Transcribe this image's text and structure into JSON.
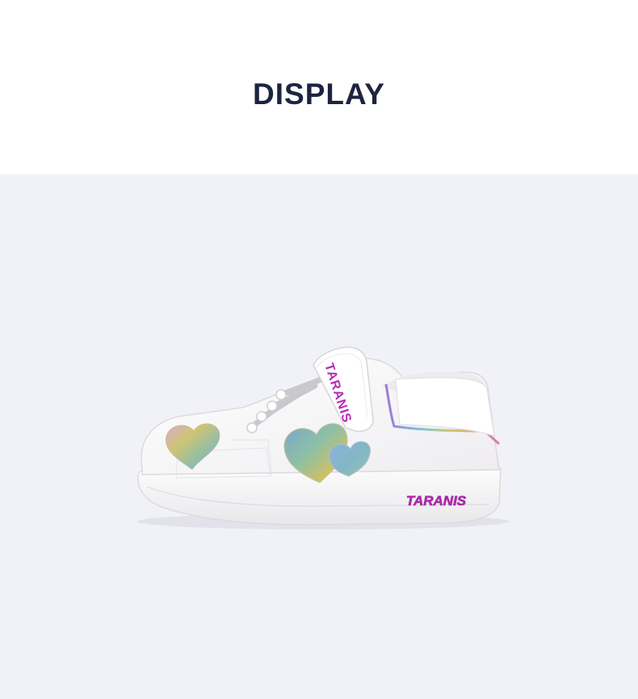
{
  "header": {
    "title": "DISPLAY"
  },
  "product": {
    "strap_brand_text": "TARANIS",
    "sole_brand_text": "TARANIS",
    "brand_color": "#b62bb5",
    "background_color": "#f1f2f8"
  }
}
